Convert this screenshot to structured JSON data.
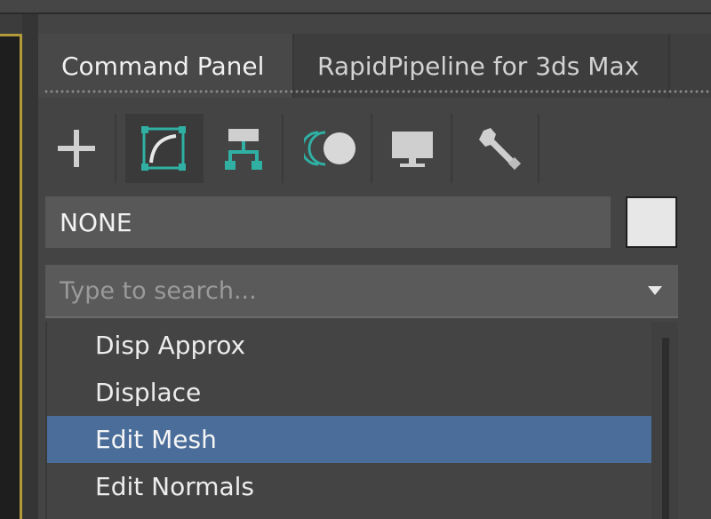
{
  "tabs": [
    {
      "label": "Command Panel",
      "active": true
    },
    {
      "label": "RapidPipeline for 3ds Max",
      "active": false
    }
  ],
  "toolbar": {
    "buttons": [
      {
        "icon": "create-icon",
        "active": false
      },
      {
        "icon": "modify-icon",
        "active": true
      },
      {
        "icon": "hierarchy-icon",
        "active": false
      },
      {
        "icon": "motion-icon",
        "active": false
      },
      {
        "icon": "display-icon",
        "active": false
      },
      {
        "icon": "utilities-icon",
        "active": false
      }
    ]
  },
  "object": {
    "name": "NONE",
    "color": "#e7e7e7"
  },
  "modifier_search": {
    "placeholder": "Type to search...",
    "value": ""
  },
  "modifier_list": {
    "items": [
      "Disp Approx",
      "Displace",
      "Edit Mesh",
      "Edit Normals"
    ],
    "selected": "Edit Mesh"
  },
  "colors": {
    "accent_teal": "#2fb0a3",
    "selection_blue": "#4a6d9a",
    "viewport_border": "#b29a3a"
  }
}
